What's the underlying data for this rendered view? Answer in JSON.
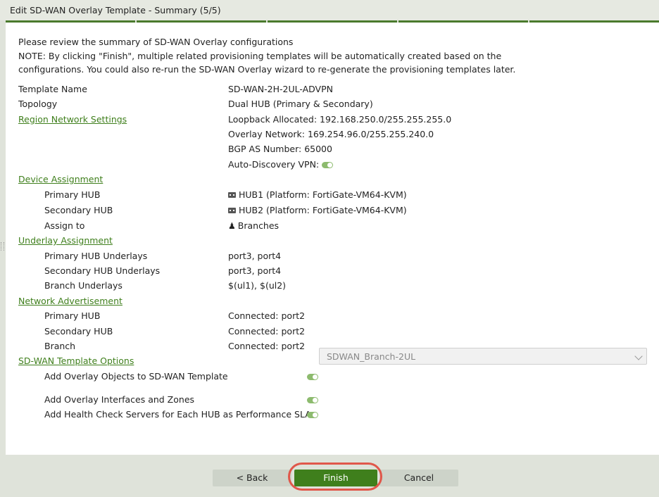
{
  "window": {
    "title": "Edit SD-WAN Overlay Template - Summary (5/5)"
  },
  "intro": {
    "line1": "Please review the summary of SD-WAN Overlay configurations",
    "note": "NOTE: By clicking \"Finish\", multiple related provisioning templates will be automatically created based on the configurations. You could also re-run the SD-WAN Overlay wizard to re-generate the provisioning templates later."
  },
  "summary": {
    "template_name_label": "Template Name",
    "template_name_value": "SD-WAN-2H-2UL-ADVPN",
    "topology_label": "Topology",
    "topology_value": "Dual HUB (Primary & Secondary)",
    "region_section": "Region Network Settings",
    "loopback": "Loopback Allocated: 192.168.250.0/255.255.255.0",
    "overlay_network": "Overlay Network: 169.254.96.0/255.255.240.0",
    "bgp_as": "BGP AS Number: 65000",
    "advpn_label": "Auto-Discovery VPN:",
    "advpn_enabled": true,
    "device_section": "Device Assignment",
    "primary_hub_label": "Primary HUB",
    "primary_hub_value": "HUB1 (Platform: FortiGate-VM64-KVM)",
    "secondary_hub_label": "Secondary HUB",
    "secondary_hub_value": "HUB2 (Platform: FortiGate-VM64-KVM)",
    "assign_to_label": "Assign to",
    "assign_to_value": "Branches",
    "underlay_section": "Underlay Assignment",
    "primary_underlays_label": "Primary HUB Underlays",
    "primary_underlays_value": "port3, port4",
    "secondary_underlays_label": "Secondary HUB Underlays",
    "secondary_underlays_value": "port3, port4",
    "branch_underlays_label": "Branch Underlays",
    "branch_underlays_value": "$(ul1), $(ul2)",
    "network_section": "Network Advertisement",
    "na_primary_label": "Primary HUB",
    "na_primary_value": "Connected: port2",
    "na_secondary_label": "Secondary HUB",
    "na_secondary_value": "Connected: port2",
    "na_branch_label": "Branch",
    "na_branch_value": "Connected: port2",
    "options_section": "SD-WAN Template Options",
    "opt1_label": "Add Overlay Objects to SD-WAN Template",
    "opt1_select_value": "SDWAN_Branch-2UL",
    "opt2_label": "Add Overlay Interfaces and Zones",
    "opt3_label": "Add Health Check Servers for Each HUB as Performance SLA"
  },
  "footer": {
    "back_label": "< Back",
    "finish_label": "Finish",
    "cancel_label": "Cancel"
  },
  "colors": {
    "accent": "#3f7f1c",
    "toggle_on": "#8dbb6e",
    "highlight_ring": "#e0574a"
  },
  "icons": {
    "device": "fortigate-device-icon",
    "group": "device-group-icon"
  }
}
